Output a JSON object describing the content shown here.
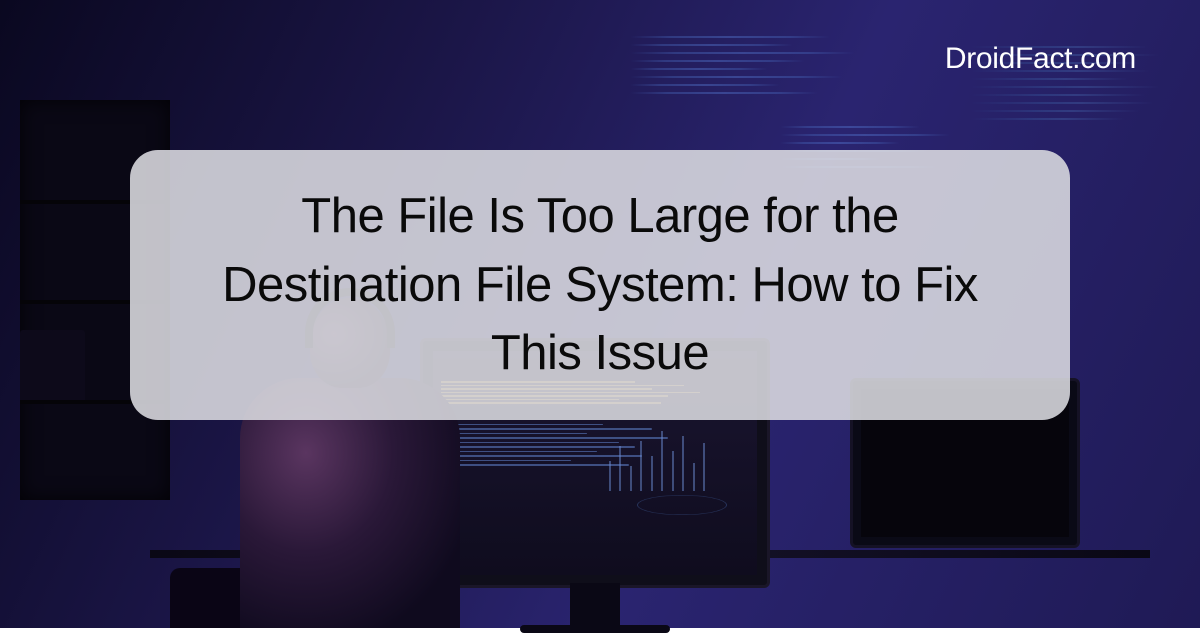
{
  "brand": "DroidFact.com",
  "title": "The File Is Too Large for the Destination File System: How to Fix This Issue",
  "colors": {
    "background_gradient_start": "#0a0820",
    "background_gradient_end": "#2a2470",
    "card_background": "rgba(220, 220, 225, 0.88)",
    "title_color": "#0a0a0a",
    "brand_color": "#ffffff",
    "code_glow": "#4a6fc4"
  }
}
